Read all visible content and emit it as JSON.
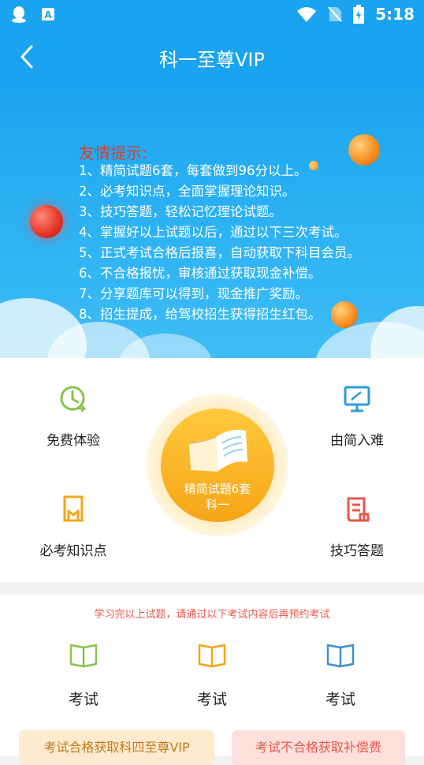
{
  "status_bar": {
    "time": "5:18",
    "icons": [
      "qq-icon",
      "a-icon",
      "wifi-icon",
      "no-sim-icon",
      "battery-icon"
    ]
  },
  "header": {
    "title": "科一至尊VIP"
  },
  "banner": {
    "tips_title": "友情提示:",
    "tips": [
      "1、精简试题6套，每套做到96分以上。",
      "2、必考知识点，全面掌握理论知识。",
      "3、技巧答题，轻松记忆理论试题。",
      "4、掌握好以上试题以后，通过以下三次考试。",
      "5、正式考试合格后报喜，自动获取下科目会员。",
      "6、不合格报忧，审核通过获取现金补偿。",
      "7、分享题库可以得到，现金推广奖励。",
      "8、招生提成，给驾校招生获得招生红包。"
    ]
  },
  "features": {
    "free_trial": "免费体验",
    "easy_to_hard": "由简入难",
    "must_know": "必考知识点",
    "tips_answer": "技巧答题",
    "center_line1": "精简试题6套",
    "center_line2": "科一"
  },
  "exams": {
    "notice": "学习完以上试题，请通过以下考试内容后再预约考试",
    "items": [
      "考试",
      "考试",
      "考试"
    ],
    "pass_button": "考试合格获取科四至尊VIP",
    "fail_button": "考试不合格获取补偿费"
  },
  "colors": {
    "primary": "#1aa3f0",
    "accent_orange": "#f5a516",
    "green": "#8bc34a",
    "red": "#e8574d",
    "blue": "#3c8fd6"
  }
}
